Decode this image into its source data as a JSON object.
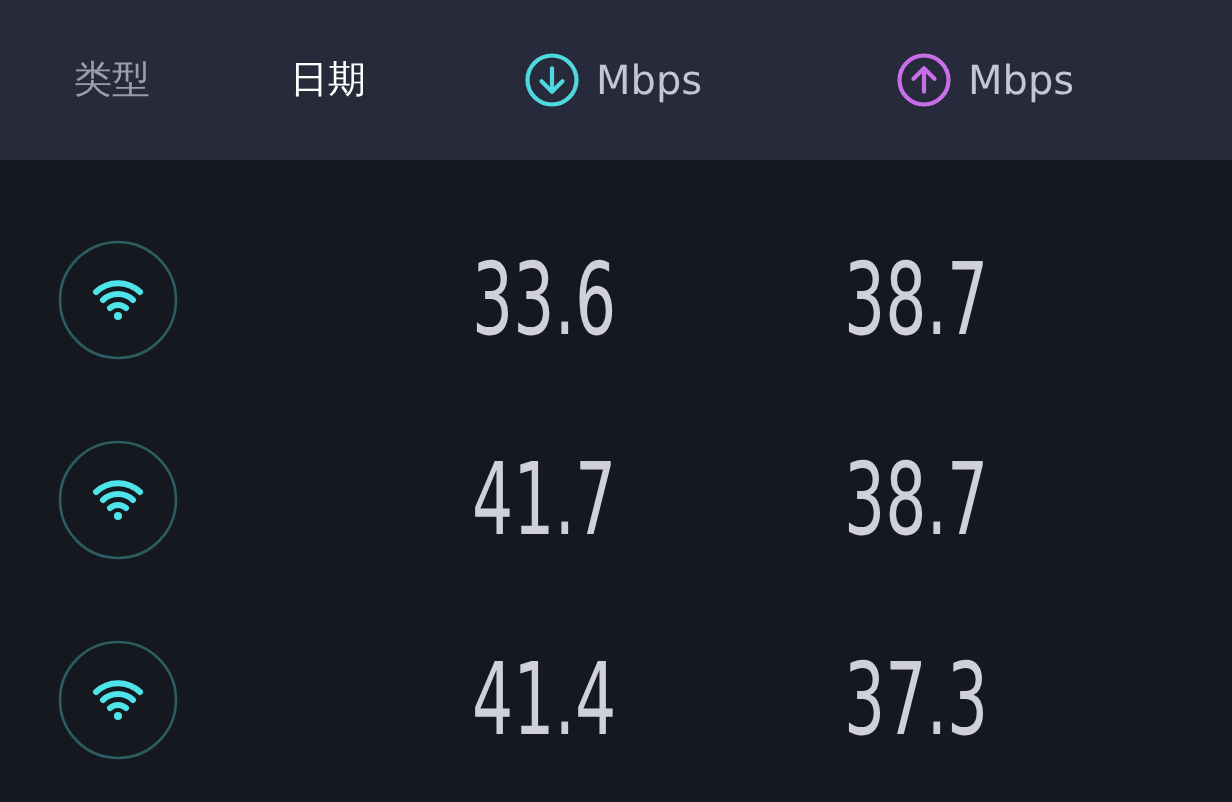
{
  "header": {
    "tabs": [
      {
        "label": "类型",
        "selected": false
      },
      {
        "label": "日期",
        "selected": true
      }
    ],
    "columns": [
      {
        "kind": "download",
        "label": "Mbps",
        "color": "#4fd8e0"
      },
      {
        "kind": "upload",
        "label": "Mbps",
        "color": "#c86ee8"
      }
    ]
  },
  "results": [
    {
      "kind": "wifi",
      "download": "33.6",
      "upload": "38.7"
    },
    {
      "kind": "wifi",
      "download": "41.7",
      "upload": "38.7"
    },
    {
      "kind": "wifi",
      "download": "41.4",
      "upload": "37.3"
    }
  ]
}
